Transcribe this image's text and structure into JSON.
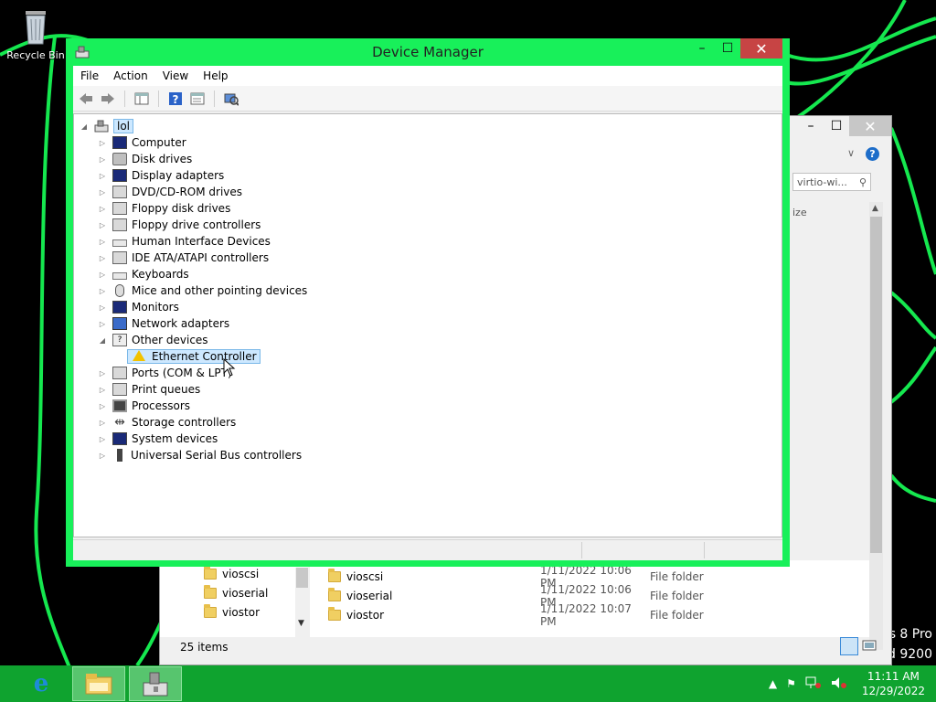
{
  "desktop": {
    "recycle_bin_label": "Recycle Bin",
    "watermark_line1": "s 8 Pro",
    "watermark_line2": "d 9200"
  },
  "device_manager": {
    "title": "Device Manager",
    "menu": [
      "File",
      "Action",
      "View",
      "Help"
    ],
    "root_label": "lol",
    "categories": [
      {
        "label": "Computer",
        "icon": "computer-icon"
      },
      {
        "label": "Disk drives",
        "icon": "disk-drive-icon"
      },
      {
        "label": "Display adapters",
        "icon": "display-adapter-icon"
      },
      {
        "label": "DVD/CD-ROM drives",
        "icon": "dvd-drive-icon"
      },
      {
        "label": "Floppy disk drives",
        "icon": "floppy-disk-icon"
      },
      {
        "label": "Floppy drive controllers",
        "icon": "floppy-controller-icon"
      },
      {
        "label": "Human Interface Devices",
        "icon": "hid-icon"
      },
      {
        "label": "IDE ATA/ATAPI controllers",
        "icon": "ide-controller-icon"
      },
      {
        "label": "Keyboards",
        "icon": "keyboard-icon"
      },
      {
        "label": "Mice and other pointing devices",
        "icon": "mouse-icon"
      },
      {
        "label": "Monitors",
        "icon": "monitor-icon"
      },
      {
        "label": "Network adapters",
        "icon": "network-adapter-icon"
      },
      {
        "label": "Other devices",
        "icon": "unknown-device-icon",
        "expanded": true
      },
      {
        "label": "Ports (COM & LPT)",
        "icon": "port-icon"
      },
      {
        "label": "Print queues",
        "icon": "printer-icon"
      },
      {
        "label": "Processors",
        "icon": "processor-icon"
      },
      {
        "label": "Storage controllers",
        "icon": "storage-controller-icon"
      },
      {
        "label": "System devices",
        "icon": "system-device-icon"
      },
      {
        "label": "Universal Serial Bus controllers",
        "icon": "usb-icon"
      }
    ],
    "other_devices_child": {
      "label": "Ethernet Controller",
      "icon": "warning-icon"
    }
  },
  "explorer": {
    "search_placeholder": "virtio-wi...",
    "column_size": "ize",
    "nav_items": [
      "vioscsi",
      "vioserial",
      "viostor"
    ],
    "files": [
      {
        "name": "vioscsi",
        "date": "1/11/2022 10:06 PM",
        "type": "File folder"
      },
      {
        "name": "vioserial",
        "date": "1/11/2022 10:06 PM",
        "type": "File folder"
      },
      {
        "name": "viostor",
        "date": "1/11/2022 10:07 PM",
        "type": "File folder"
      }
    ],
    "status": "25 items"
  },
  "taskbar": {
    "time": "11:11 AM",
    "date": "12/29/2022"
  }
}
